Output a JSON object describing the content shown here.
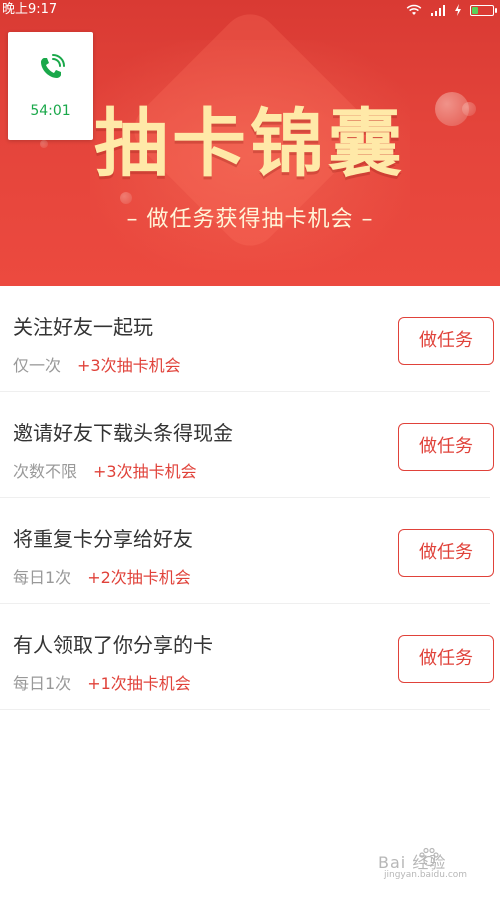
{
  "status_bar": {
    "time": "晚上9:17"
  },
  "call": {
    "timer": "54:01",
    "icon": "phone-icon",
    "color": "#1aa84a"
  },
  "header": {
    "title": "抽卡锦囊",
    "subtitle": "– 做任务获得抽卡机会 –",
    "background_color": "#e4443b",
    "title_color": "#ffe9a8"
  },
  "tasks": [
    {
      "title": "关注好友一起玩",
      "frequency": "仅一次",
      "reward": "+3次抽卡机会",
      "button_label": "做任务"
    },
    {
      "title": "邀请好友下载头条得现金",
      "frequency": "次数不限",
      "reward": "+3次抽卡机会",
      "button_label": "做任务"
    },
    {
      "title": "将重复卡分享给好友",
      "frequency": "每日1次",
      "reward": "+2次抽卡机会",
      "button_label": "做任务"
    },
    {
      "title": "有人领取了你分享的卡",
      "frequency": "每日1次",
      "reward": "+1次抽卡机会",
      "button_label": "做任务"
    }
  ],
  "accent_color": "#e0423a",
  "watermark": {
    "main": "Bai 经验",
    "sub": "jingyan.baidu.com"
  }
}
